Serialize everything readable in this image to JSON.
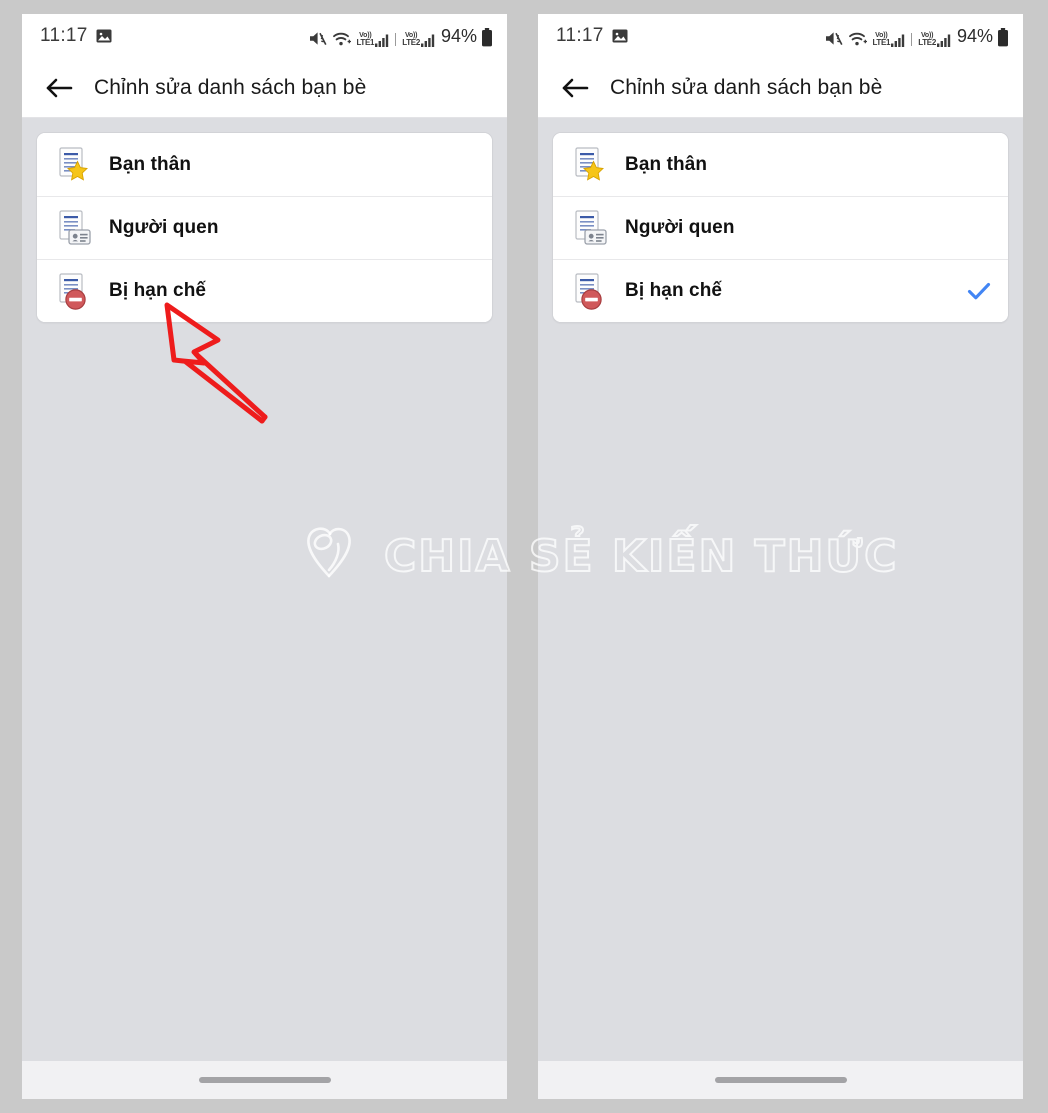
{
  "meta": {
    "accent_blue": "#4285f4",
    "annotation_red": "#ee1c1c",
    "star_yellow": "#f5c518",
    "restricted_red": "#d9534f",
    "page_bg": "#dcdde1",
    "card_bg": "#ffffff"
  },
  "watermark": {
    "text": "CHIA SẺ KIẾN THỨC",
    "logo_icon": "hands-heart-logo-icon"
  },
  "panels": [
    {
      "id": "before",
      "statusbar": {
        "clock": "11:17",
        "icons": [
          "image-icon",
          "volume-mute-icon",
          "wifi-icon",
          "volte-lte1-icon",
          "signal-bars-icon",
          "volte-lte2-icon",
          "signal-bars-icon",
          "battery-icon"
        ],
        "volte_1": {
          "vo": "Vo))",
          "lte": "LTE1"
        },
        "volte_2": {
          "vo": "Vo))",
          "lte": "LTE2"
        },
        "battery_text": "94%"
      },
      "appbar": {
        "back_icon": "arrow-left-icon",
        "title": "Chỉnh sửa danh sách bạn bè"
      },
      "rows": [
        {
          "label": "Bạn thân",
          "icon": "document-star-icon",
          "checked": false
        },
        {
          "label": "Người quen",
          "icon": "document-idcard-icon",
          "checked": false
        },
        {
          "label": "Bị hạn chế",
          "icon": "document-restricted-icon",
          "checked": false
        }
      ],
      "annotation": {
        "type": "arrow-pointer",
        "color": "#ee1c1c",
        "points_at": "Bị hạn chế"
      },
      "home_indicator": true
    },
    {
      "id": "after",
      "statusbar": {
        "clock": "11:17",
        "icons": [
          "image-icon",
          "volume-mute-icon",
          "wifi-icon",
          "volte-lte1-icon",
          "signal-bars-icon",
          "volte-lte2-icon",
          "signal-bars-icon",
          "battery-icon"
        ],
        "volte_1": {
          "vo": "Vo))",
          "lte": "LTE1"
        },
        "volte_2": {
          "vo": "Vo))",
          "lte": "LTE2"
        },
        "battery_text": "94%"
      },
      "appbar": {
        "back_icon": "arrow-left-icon",
        "title": "Chỉnh sửa danh sách bạn bè"
      },
      "rows": [
        {
          "label": "Bạn thân",
          "icon": "document-star-icon",
          "checked": false
        },
        {
          "label": "Người quen",
          "icon": "document-idcard-icon",
          "checked": false
        },
        {
          "label": "Bị hạn chế",
          "icon": "document-restricted-icon",
          "checked": true
        }
      ],
      "annotation": null,
      "home_indicator": true
    }
  ]
}
